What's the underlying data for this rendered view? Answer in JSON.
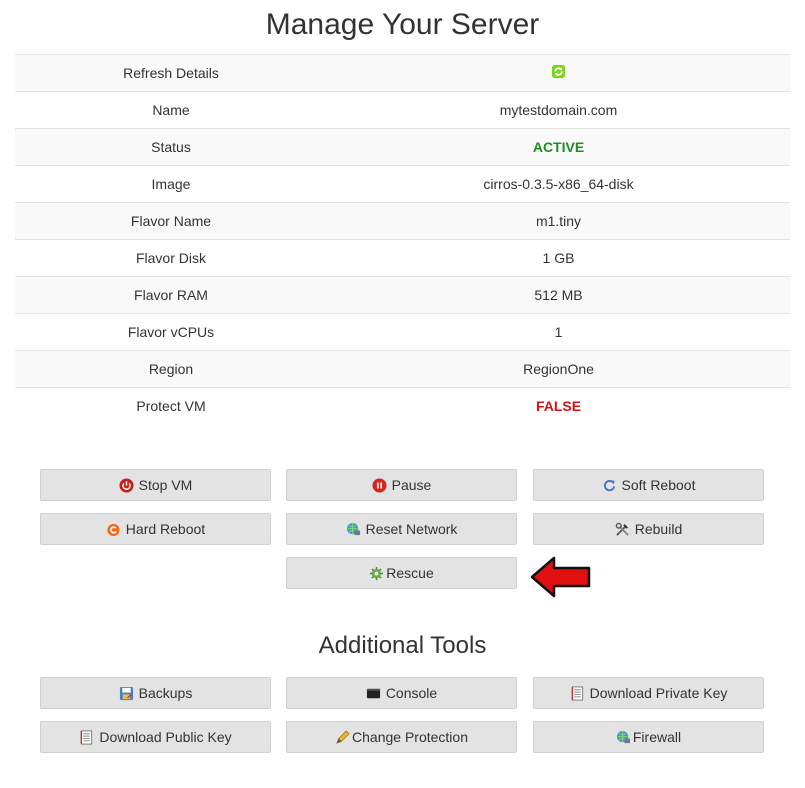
{
  "page_title": "Manage Your Server",
  "details": [
    {
      "key": "Refresh Details",
      "value": "",
      "icon": "refresh-icon"
    },
    {
      "key": "Name",
      "value": "mytestdomain.com"
    },
    {
      "key": "Status",
      "value": "ACTIVE",
      "status_color": "#1e8f1e"
    },
    {
      "key": "Image",
      "value": "cirros-0.3.5-x86_64-disk"
    },
    {
      "key": "Flavor Name",
      "value": "m1.tiny"
    },
    {
      "key": "Flavor Disk",
      "value": "1 GB"
    },
    {
      "key": "Flavor RAM",
      "value": "512 MB"
    },
    {
      "key": "Flavor vCPUs",
      "value": "1"
    },
    {
      "key": "Region",
      "value": "RegionOne"
    },
    {
      "key": "Protect VM",
      "value": "FALSE",
      "status_color": "#d01414"
    }
  ],
  "actions": {
    "stop_vm": {
      "label": "Stop VM",
      "icon": "power-icon"
    },
    "pause": {
      "label": "Pause",
      "icon": "pause-icon"
    },
    "soft_reboot": {
      "label": "Soft Reboot",
      "icon": "soft-reboot-icon"
    },
    "hard_reboot": {
      "label": "Hard Reboot",
      "icon": "hard-reboot-icon"
    },
    "reset_network": {
      "label": "Reset Network",
      "icon": "network-icon"
    },
    "rebuild": {
      "label": "Rebuild",
      "icon": "tools-icon"
    },
    "rescue": {
      "label": "Rescue",
      "icon": "rescue-icon"
    }
  },
  "additional_tools_title": "Additional Tools",
  "tools": {
    "backups": {
      "label": "Backups",
      "icon": "backup-icon"
    },
    "console": {
      "label": "Console",
      "icon": "console-icon"
    },
    "download_private_key": {
      "label": "Download Private Key",
      "icon": "document-icon"
    },
    "download_public_key": {
      "label": "Download Public Key",
      "icon": "document-icon"
    },
    "change_protection": {
      "label": "Change Protection",
      "icon": "pencil-icon"
    },
    "firewall": {
      "label": "Firewall",
      "icon": "globe-firewall-icon"
    }
  },
  "colors": {
    "button_bg": "#e3e3e3",
    "row_alt": "#f9f9f9",
    "annotation_arrow": "#e01010"
  }
}
